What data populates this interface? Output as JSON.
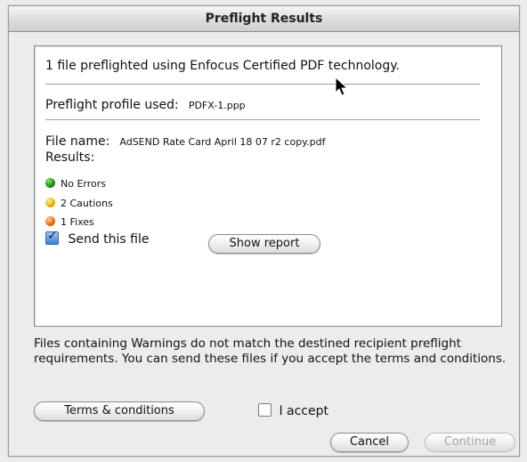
{
  "window": {
    "title": "Preflight Results"
  },
  "panel": {
    "summary": "1 file preflighted using Enfocus Certified PDF technology.",
    "profile_label": "Preflight profile used:",
    "profile_value": "PDFX-1.ppp",
    "filename_label": "File name:",
    "filename_value": "AdSEND Rate Card April 18 07 r2 copy.pdf",
    "results_label": "Results:",
    "results": [
      {
        "label": "No Errors",
        "color": "#1a8a1a"
      },
      {
        "label": "2 Cautions",
        "color": "#e0b300"
      },
      {
        "label": "1 Fixes",
        "color": "#e26d10"
      }
    ],
    "send_label": "Send this file",
    "send_checked": true,
    "show_report_label": "Show report"
  },
  "note": "Files containing Warnings do not match the destined recipient preflight requirements. You can send these files if you accept the terms and conditions.",
  "buttons": {
    "terms": "Terms & conditions",
    "accept_label": "I accept",
    "accept_checked": false,
    "cancel": "Cancel",
    "continue": "Continue"
  }
}
